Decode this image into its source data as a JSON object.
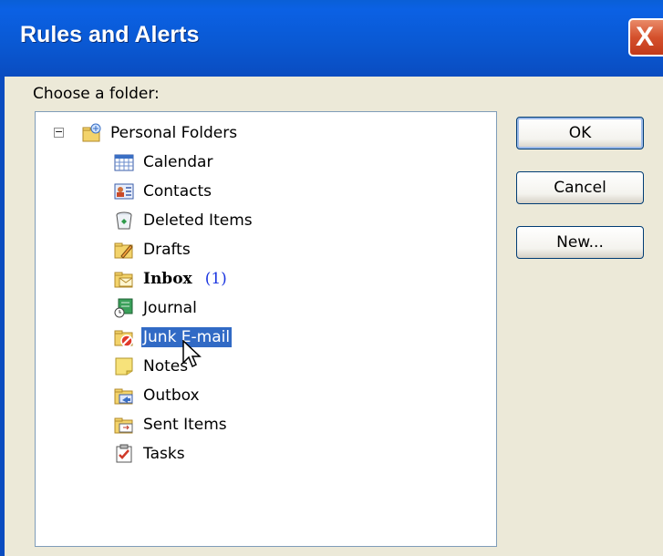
{
  "window": {
    "title": "Rules and Alerts",
    "close_glyph": "X"
  },
  "prompt": "Choose a folder:",
  "tree": {
    "root": {
      "label": "Personal Folders",
      "expander": "−",
      "icon": "personal-folders-icon"
    },
    "items": [
      {
        "label": "Calendar",
        "icon": "calendar-icon"
      },
      {
        "label": "Contacts",
        "icon": "contacts-icon"
      },
      {
        "label": "Deleted Items",
        "icon": "deleted-items-icon"
      },
      {
        "label": "Drafts",
        "icon": "drafts-icon"
      },
      {
        "label": "Inbox",
        "icon": "inbox-icon",
        "bold": true,
        "count": "(1)"
      },
      {
        "label": "Journal",
        "icon": "journal-icon"
      },
      {
        "label": "Junk E-mail",
        "icon": "junk-email-icon",
        "selected": true
      },
      {
        "label": "Notes",
        "icon": "notes-icon"
      },
      {
        "label": "Outbox",
        "icon": "outbox-icon"
      },
      {
        "label": "Sent Items",
        "icon": "sent-items-icon"
      },
      {
        "label": "Tasks",
        "icon": "tasks-icon"
      }
    ]
  },
  "buttons": {
    "ok": "OK",
    "cancel": "Cancel",
    "new": "New..."
  },
  "colors": {
    "titlebar": "#0a58d2",
    "selection": "#316ac5",
    "count": "#1a35e0",
    "dialog_bg": "#ece9d8"
  }
}
